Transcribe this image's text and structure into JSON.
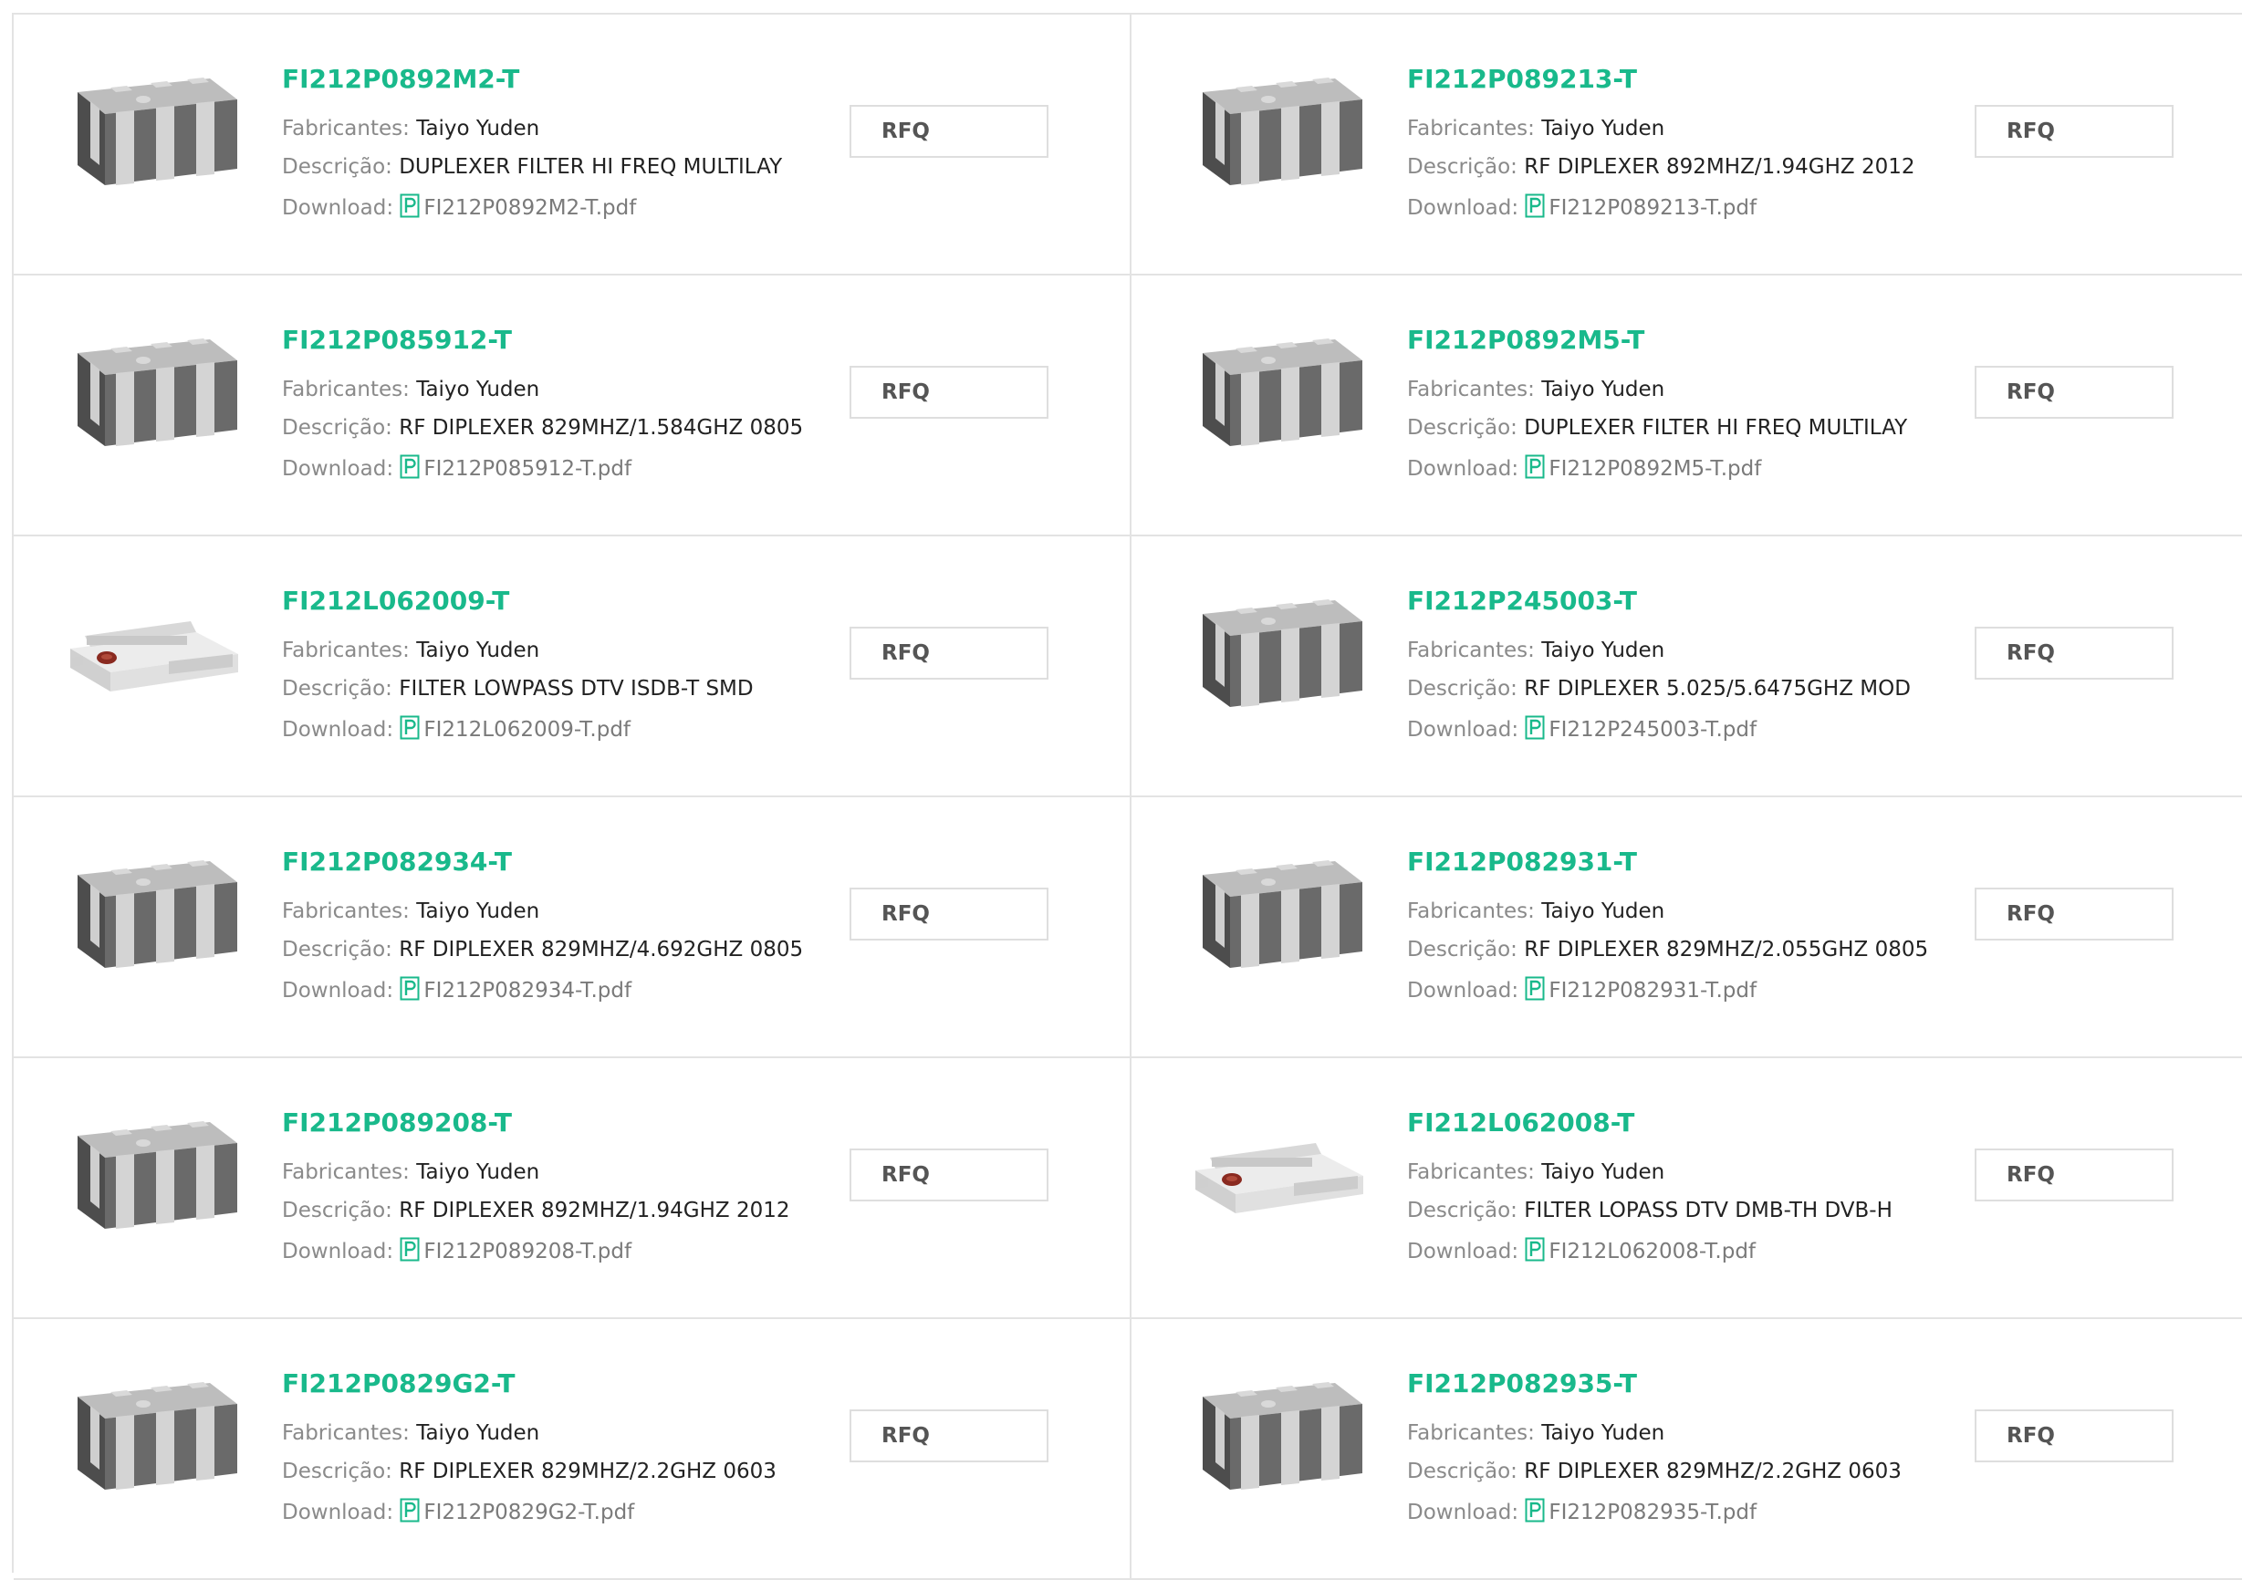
{
  "labels": {
    "manufacturer": "Fabricantes:",
    "description": "Descrição:",
    "download": "Download:",
    "rfq": "RFQ"
  },
  "colors": {
    "part_link": "#19b98b",
    "pdf_icon": "#19b98b",
    "border": "#e3e3e3"
  },
  "products": [
    {
      "part": "FI212P0892M2-T",
      "manufacturer": "Taiyo Yuden",
      "description": "DUPLEXER FILTER HI FREQ MULTILAY",
      "pdf": "FI212P0892M2-T.pdf",
      "image": "smd-dark-6pad-chip"
    },
    {
      "part": "FI212P089213-T",
      "manufacturer": "Taiyo Yuden",
      "description": "RF DIPLEXER 892MHZ/1.94GHZ 2012",
      "pdf": "FI212P089213-T.pdf",
      "image": "smd-dark-6pad-chip"
    },
    {
      "part": "FI212P085912-T",
      "manufacturer": "Taiyo Yuden",
      "description": "RF DIPLEXER 829MHZ/1.584GHZ 0805",
      "pdf": "FI212P085912-T.pdf",
      "image": "smd-dark-6pad-chip"
    },
    {
      "part": "FI212P0892M5-T",
      "manufacturer": "Taiyo Yuden",
      "description": "DUPLEXER FILTER HI FREQ MULTILAY",
      "pdf": "FI212P0892M5-T.pdf",
      "image": "smd-dark-6pad-chip"
    },
    {
      "part": "FI212L062009-T",
      "manufacturer": "Taiyo Yuden",
      "description": "FILTER LOWPASS DTV ISDB-T SMD",
      "pdf": "FI212L062009-T.pdf",
      "image": "smd-white-chip"
    },
    {
      "part": "FI212P245003-T",
      "manufacturer": "Taiyo Yuden",
      "description": "RF DIPLEXER 5.025/5.6475GHZ MOD",
      "pdf": "FI212P245003-T.pdf",
      "image": "smd-dark-6pad-chip"
    },
    {
      "part": "FI212P082934-T",
      "manufacturer": "Taiyo Yuden",
      "description": "RF DIPLEXER 829MHZ/4.692GHZ 0805",
      "pdf": "FI212P082934-T.pdf",
      "image": "smd-dark-6pad-chip"
    },
    {
      "part": "FI212P082931-T",
      "manufacturer": "Taiyo Yuden",
      "description": "RF DIPLEXER 829MHZ/2.055GHZ 0805",
      "pdf": "FI212P082931-T.pdf",
      "image": "smd-dark-6pad-chip"
    },
    {
      "part": "FI212P089208-T",
      "manufacturer": "Taiyo Yuden",
      "description": "RF DIPLEXER 892MHZ/1.94GHZ 2012",
      "pdf": "FI212P089208-T.pdf",
      "image": "smd-dark-6pad-chip"
    },
    {
      "part": "FI212L062008-T",
      "manufacturer": "Taiyo Yuden",
      "description": "FILTER LOPASS DTV DMB-TH DVB-H",
      "pdf": "FI212L062008-T.pdf",
      "image": "smd-white-chip"
    },
    {
      "part": "FI212P0829G2-T",
      "manufacturer": "Taiyo Yuden",
      "description": "RF DIPLEXER 829MHZ/2.2GHZ 0603",
      "pdf": "FI212P0829G2-T.pdf",
      "image": "smd-dark-6pad-chip"
    },
    {
      "part": "FI212P082935-T",
      "manufacturer": "Taiyo Yuden",
      "description": "RF DIPLEXER 829MHZ/2.2GHZ 0603",
      "pdf": "FI212P082935-T.pdf",
      "image": "smd-dark-6pad-chip"
    }
  ]
}
